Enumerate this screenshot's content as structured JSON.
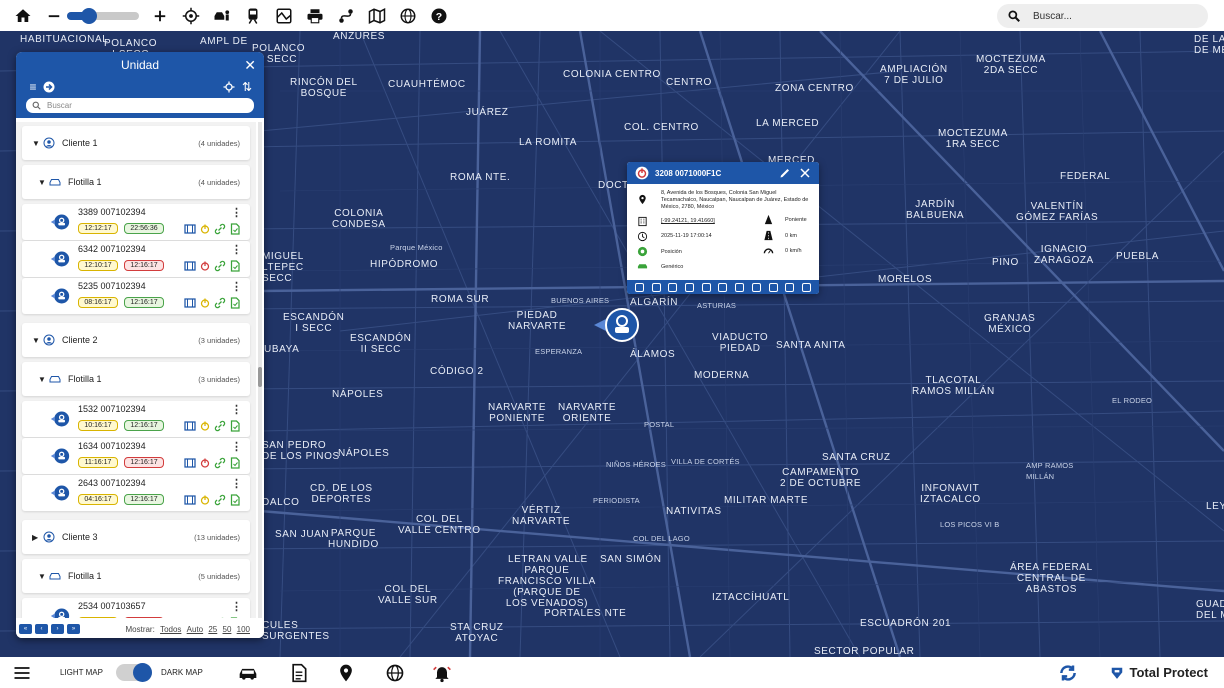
{
  "toolbar": {
    "zoom_level": 0.3,
    "search_placeholder": "Buscar..."
  },
  "map_labels": {
    "l1": "HABITUACIONAL",
    "l2": "POLANCO\nI SECC",
    "l3": "AMPL DE",
    "l4": "POLANCO\nI SECC",
    "l5": "ANZURES",
    "l6": "RINCÓN DEL\nBOSQUE",
    "l7": "CUAUHTÉMOC",
    "l8": "COLONIA CENTRO",
    "l9": "CENTRO",
    "l10": "ZONA CENTRO",
    "l11": "JUÁREZ",
    "l12": "COL. CENTRO",
    "l13": "LA MERCED",
    "l14": "LA ROMITA",
    "l15": "ROMA NTE.",
    "l16": "COLONIA\nCONDESA",
    "l17": "HIPÓDROMO",
    "l18": "Parque México",
    "l19": "ROMA SUR",
    "l20": "PIEDAD\nNARVARTE",
    "l21": "ALGARÍN",
    "l22": "ÁLAMOS",
    "l23": "VIADUCTO\nPIEDAD",
    "l24": "SANTA ANITA",
    "l25": "MODERNA",
    "l26": "CÓDIGO 2",
    "l27": "NÁPOLES",
    "l28": "NARVARTE\nPONIENTE",
    "l29": "NARVARTE\nORIENTE",
    "l30": "ESCANDÓN\nI SECC",
    "l31": "ESCANDÓN\nII SECC",
    "l32": "MIGUEL\nLTEPEC\nSECC",
    "l33": "SAN PEDRO\nDE LOS PINOS",
    "l34": "NÁPOLES",
    "l35": "CD. DE LOS\nDEPORTES",
    "l36": "COL DEL\nVALLE CENTRO",
    "l37": "VÉRTIZ\nNARVARTE",
    "l38": "NATIVITAS",
    "l39": "MILITAR MARTE",
    "l40": "CAMPAMENTO\n2 DE OCTUBRE",
    "l41": "SANTA CRUZ",
    "l42": "INFONAVIT\nIZTACALCO",
    "l43": "TLACOTAL\nRAMOS MILLÁN",
    "l44": "GRANJAS\nMÉXICO",
    "l45": "PINO",
    "l46": "IGNACIO\nZARAGOZA",
    "l47": "PUEBLA",
    "l48": "MORELOS",
    "l49": "JARDÍN\nBALBUENA",
    "l50": "VALENTÍN\nGÓMEZ FARÍAS",
    "l51": "FEDERAL",
    "l52": "MOCTEZUMA\n1RA SECC",
    "l53": "MOCTEZUMA\n2DA SECC",
    "l54": "AMPLIACIÓN\n7 DE JULIO",
    "l55": "LETRAN VALLE",
    "l56": "SAN SIMÓN",
    "l57": "PORTALES NTE",
    "l58": "COL DEL\nVALLE SUR",
    "l59": "STA CRUZ\nATOYAC",
    "l60": "IZTACCÍHUATL",
    "l61": "ESCUADRÓN 201",
    "l62": "SECTOR POPULAR",
    "l63": "ÁREA FEDERAL\nCENTRAL DE\nABASTOS",
    "l64": "Parque\nFrancisco Villa\n(Parque de\nlos Venados)",
    "l65": "Parque\nHundido",
    "l66": "SAN JUAN",
    "l67": "DALCO",
    "l68": "UBAYA",
    "l69": "CULES\nSURGENTES",
    "l70": "BUENOS AIRES",
    "l71": "ESPERANZA",
    "l72": "ASTURIAS",
    "l73": "DOCT",
    "l74": "MERCED",
    "l75": "POSTAL",
    "l76": "NIÑOS HÉROES",
    "l77": "VILLA DE CORTÉS",
    "l78": "PERIODISTA",
    "l79": "COL DEL LAGO",
    "l80": "LOS PICOS VI B",
    "l81": "AMP RAMOS\nMILLÁN",
    "l82": "EL RODEO",
    "l83": "LEY",
    "l84": "GUADALUP\nDEL MORAL",
    "l85": "de la\nde Mé"
  },
  "panel": {
    "title": "Unidad",
    "search_placeholder": "Buscar",
    "clients": [
      {
        "name": "Cliente 1",
        "count": "(4 unidades)",
        "fleet": {
          "name": "Flotilla 1",
          "count": "(4 unidades)"
        },
        "units": [
          {
            "name": "3389 007102394",
            "t1": "12:12:17",
            "t2": "22:56:36",
            "t2_status": "ok"
          },
          {
            "name": "6342 007102394",
            "t1": "12:10:17",
            "t2": "12:16:17",
            "t2_status": "alert"
          },
          {
            "name": "5235 007102394",
            "t1": "08:16:17",
            "t2": "12:16:17",
            "t2_status": "ok"
          }
        ]
      },
      {
        "name": "Cliente 2",
        "count": "(3 unidades)",
        "fleet": {
          "name": "Flotilla 1",
          "count": "(3 unidades)"
        },
        "units": [
          {
            "name": "1532 007102394",
            "t1": "10:16:17",
            "t2": "12:16:17",
            "t2_status": "ok"
          },
          {
            "name": "1634 007102394",
            "t1": "11:16:17",
            "t2": "12:16:17",
            "t2_status": "alert"
          },
          {
            "name": "2643 007102394",
            "t1": "04:16:17",
            "t2": "12:16:17",
            "t2_status": "ok"
          }
        ]
      },
      {
        "name": "Cliente 3",
        "count": "(13 unidades)",
        "fleet": {
          "name": "Flotilla 1",
          "count": "(5 unidades)"
        },
        "units": [
          {
            "name": "2534 007103657",
            "t1": "11:16:17",
            "t2": "12:16:17",
            "t2_status": "alert"
          }
        ]
      }
    ],
    "footer": {
      "pages": [
        "«",
        "‹",
        "›",
        "»"
      ],
      "show_label": "Mostrar:",
      "show_options": [
        "Todos",
        "Auto",
        "25",
        "50",
        "100"
      ]
    }
  },
  "popup": {
    "title": "3208 0071000F1C",
    "address": "8, Avenida de los Bosques, Colonia San Miguel Tecamachalco, Naucalpan, Naucalpan de Juárez, Estado de México, 2780, México",
    "coords": "[-99.24121, 19.41660]",
    "datetime": "2025-11-19 17:00:14",
    "position": "Posición",
    "vehicle": "Genérico",
    "direction": "Poniente",
    "distance": "0 km",
    "speed": "0 km/h"
  },
  "bottombar": {
    "light_label": "LIGHT MAP",
    "dark_label": "DARK MAP",
    "brand": "Total Protect"
  },
  "colors": {
    "primary": "#1e56a8",
    "map_bg": "#203466",
    "ok": "#4aa34a",
    "alert": "#d23c3c",
    "warn": "#d9b400"
  }
}
